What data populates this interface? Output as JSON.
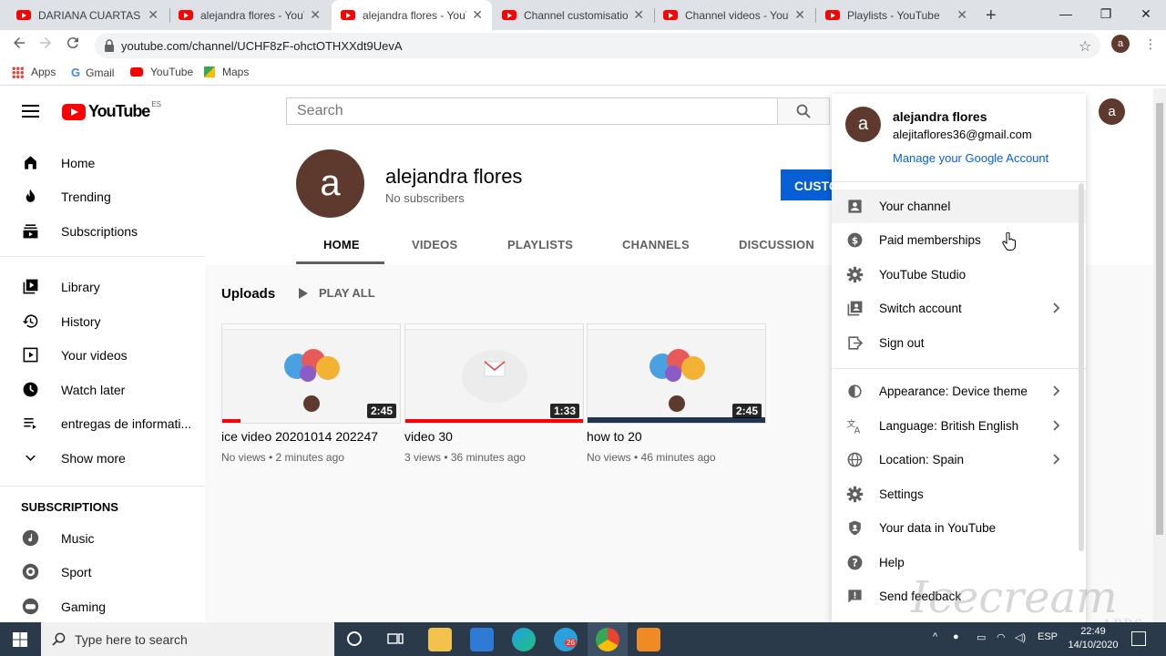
{
  "browser": {
    "tabs": [
      {
        "label": "DARIANA CUARTAS - Yo"
      },
      {
        "label": "alejandra flores - YouTu"
      },
      {
        "label": "alejandra flores - YouTu"
      },
      {
        "label": "Channel customisation"
      },
      {
        "label": "Channel videos - YouTu"
      },
      {
        "label": "Playlists - YouTube"
      }
    ],
    "url": "youtube.com/channel/UCHF8zF-ohctOTHXXdt9UevA",
    "profile_letter": "a",
    "bookmarks": [
      {
        "label": "Apps"
      },
      {
        "label": "Gmail"
      },
      {
        "label": "YouTube"
      },
      {
        "label": "Maps"
      }
    ]
  },
  "youtube": {
    "logo_text": "YouTube",
    "logo_region": "ES",
    "search_placeholder": "Search",
    "avatar_letter": "a",
    "guide": {
      "main": [
        {
          "label": "Home",
          "icon": "home-icon"
        },
        {
          "label": "Trending",
          "icon": "trending-icon"
        },
        {
          "label": "Subscriptions",
          "icon": "subscriptions-icon"
        }
      ],
      "library": [
        {
          "label": "Library",
          "icon": "library-icon"
        },
        {
          "label": "History",
          "icon": "history-icon"
        },
        {
          "label": "Your videos",
          "icon": "your-videos-icon"
        },
        {
          "label": "Watch later",
          "icon": "watch-later-icon"
        },
        {
          "label": "entregas de informati...",
          "icon": "playlist-icon"
        },
        {
          "label": "Show more",
          "icon": "chevron-down-icon"
        }
      ],
      "subscriptions_title": "SUBSCRIPTIONS",
      "subscriptions": [
        {
          "label": "Music",
          "icon": "music-icon"
        },
        {
          "label": "Sport",
          "icon": "sport-icon"
        },
        {
          "label": "Gaming",
          "icon": "gaming-icon"
        }
      ]
    },
    "channel": {
      "avatar_letter": "a",
      "name": "alejandra flores",
      "subscribers": "No subscribers",
      "customise_button": "CUSTO",
      "tabs": [
        "HOME",
        "VIDEOS",
        "PLAYLISTS",
        "CHANNELS",
        "DISCUSSION"
      ],
      "active_tab": "HOME"
    },
    "uploads": {
      "title": "Uploads",
      "play_all": "PLAY ALL",
      "videos": [
        {
          "title": "ice video 20201014 202247",
          "meta": "No views • 2 minutes ago",
          "duration": "2:45",
          "progress": 0.1
        },
        {
          "title": "video 30",
          "meta": "3 views • 36 minutes ago",
          "duration": "1:33",
          "progress": 1.0
        },
        {
          "title": "how to 20",
          "meta": "No views • 46 minutes ago",
          "duration": "2:45",
          "progress": 0.0
        }
      ]
    },
    "account_menu": {
      "avatar_letter": "a",
      "name": "alejandra flores",
      "email": "alejitaflores36@gmail.com",
      "manage": "Manage your Google Account",
      "group1": [
        {
          "label": "Your channel",
          "icon": "person-icon",
          "chevron": false
        },
        {
          "label": "Paid memberships",
          "icon": "dollar-icon",
          "chevron": false
        },
        {
          "label": "YouTube Studio",
          "icon": "gear-icon",
          "chevron": false
        },
        {
          "label": "Switch account",
          "icon": "switch-account-icon",
          "chevron": true
        },
        {
          "label": "Sign out",
          "icon": "sign-out-icon",
          "chevron": false
        }
      ],
      "group2": [
        {
          "label": "Appearance: Device theme",
          "icon": "appearance-icon",
          "chevron": true
        },
        {
          "label": "Language: British English",
          "icon": "language-icon",
          "chevron": true
        },
        {
          "label": "Location: Spain",
          "icon": "globe-icon",
          "chevron": true
        },
        {
          "label": "Settings",
          "icon": "gear-icon",
          "chevron": false
        },
        {
          "label": "Your data in YouTube",
          "icon": "shield-icon",
          "chevron": false
        },
        {
          "label": "Help",
          "icon": "help-icon",
          "chevron": false
        },
        {
          "label": "Send feedback",
          "icon": "feedback-icon",
          "chevron": false
        }
      ]
    }
  },
  "taskbar": {
    "search_placeholder": "Type here to search",
    "mail_badge": "26",
    "language": "ESP",
    "time": "22:49",
    "date": "14/10/2020"
  },
  "watermark": "Icecream",
  "watermark_sub": "APPS"
}
